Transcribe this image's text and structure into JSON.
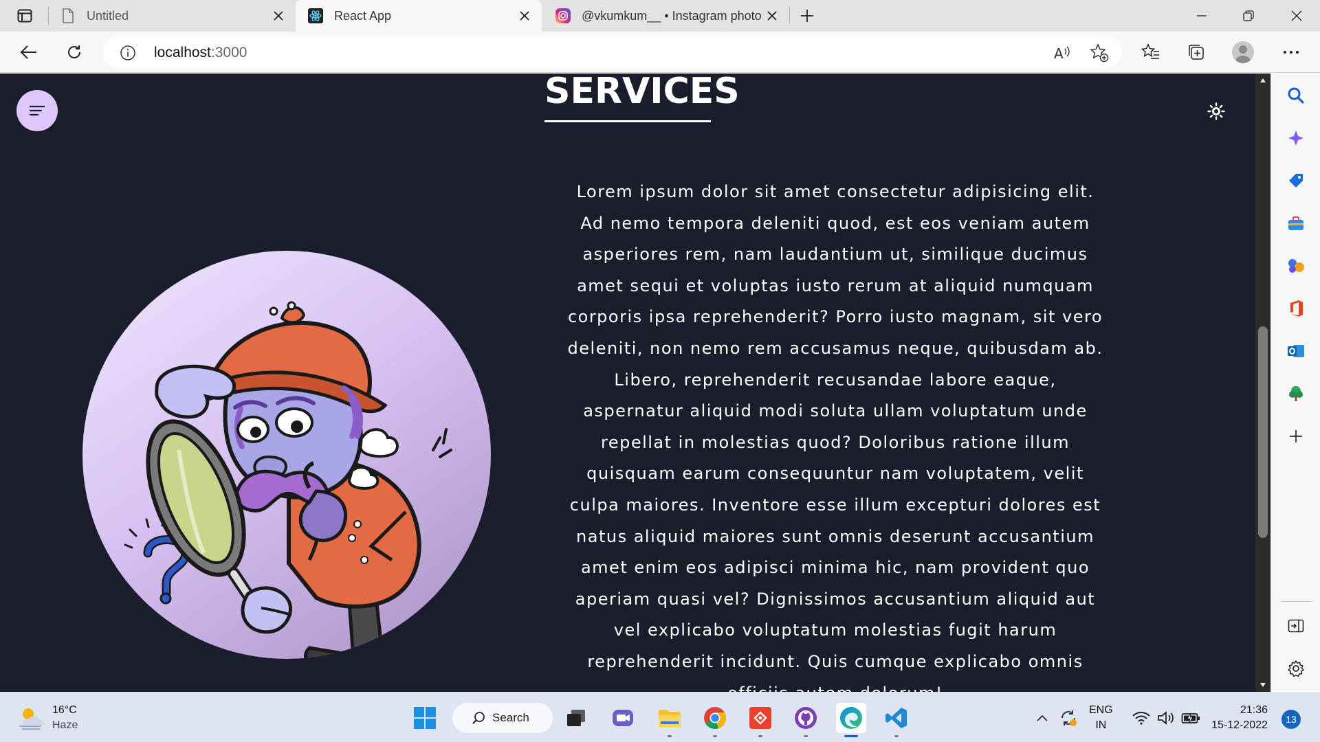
{
  "browser": {
    "tabs": [
      {
        "title": "Untitled",
        "favicon": "page-icon"
      },
      {
        "title": "React App",
        "favicon": "react-icon",
        "active": true
      },
      {
        "title": "@vkumkum__ • Instagram photo",
        "favicon": "instagram-icon"
      }
    ],
    "address": {
      "host": "localhost",
      "port": ":3000"
    }
  },
  "page": {
    "heading": "SERVICES",
    "body": "Lorem ipsum dolor sit amet consectetur adipisicing elit. Ad nemo tempora deleniti quod, est eos veniam autem asperiores rem, nam laudantium ut, similique ducimus amet sequi et voluptas iusto rerum at aliquid numquam corporis ipsa reprehenderit? Porro iusto magnam, sit vero deleniti, non nemo rem accusamus neque, quibusdam ab. Libero, reprehenderit recusandae labore eaque, aspernatur aliquid modi soluta ullam voluptatum unde repellat in molestias quod? Doloribus ratione illum quisquam earum consequuntur nam voluptatem, velit culpa maiores. Inventore esse illum excepturi dolores est natus aliquid maiores sunt omnis deserunt accusantium amet enim eos adipisci minima hic, nam provident quo aperiam quasi vel? Dignissimos accusantium aliquid aut vel explicabo voluptatum molestias fugit harum reprehenderit incidunt. Quis cumque explicabo omnis officiis autem dolorum!",
    "colors": {
      "background": "#1a1d2b",
      "accent": "#e0c7fb"
    }
  },
  "taskbar": {
    "weather": {
      "temp": "16°C",
      "desc": "Haze"
    },
    "search_label": "Search",
    "language": {
      "line1": "ENG",
      "line2": "IN"
    },
    "clock": {
      "time": "21:36",
      "date": "15-12-2022"
    },
    "notification_count": "13"
  }
}
